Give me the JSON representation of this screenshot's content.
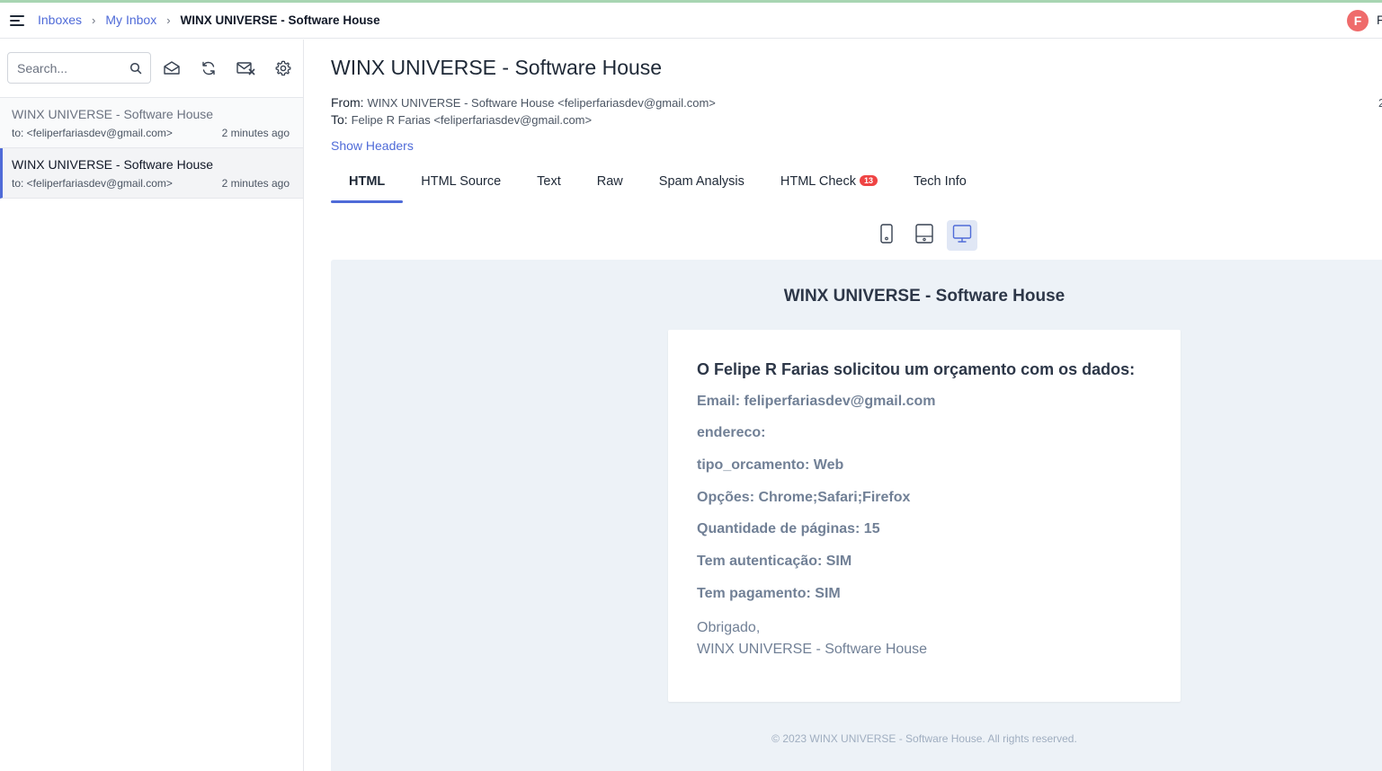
{
  "breadcrumb": {
    "inboxes": "Inboxes",
    "my_inbox": "My Inbox",
    "current": "WINX UNIVERSE - Software House"
  },
  "user": {
    "initial": "F",
    "cut_text": "F"
  },
  "sidebar": {
    "search_placeholder": "Search...",
    "messages": [
      {
        "subject": "WINX UNIVERSE - Software House",
        "to": "to: <feliperfariasdev@gmail.com>",
        "time": "2 minutes ago",
        "active": false
      },
      {
        "subject": "WINX UNIVERSE - Software House",
        "to": "to: <feliperfariasdev@gmail.com>",
        "time": "2 minutes ago",
        "active": true
      }
    ]
  },
  "email": {
    "title": "WINX UNIVERSE - Software House",
    "from_label": "From:",
    "from_value": "WINX UNIVERSE - Software House <feliperfariasdev@gmail.com>",
    "to_label": "To:",
    "to_value": "Felipe R Farias <feliperfariasdev@gmail.com>",
    "date_cut": "2",
    "show_headers": "Show Headers"
  },
  "tabs": [
    {
      "label": "HTML",
      "active": true
    },
    {
      "label": "HTML Source"
    },
    {
      "label": "Text"
    },
    {
      "label": "Raw"
    },
    {
      "label": "Spam Analysis"
    },
    {
      "label": "HTML Check",
      "badge": "13"
    },
    {
      "label": "Tech Info"
    }
  ],
  "devices": [
    "phone-icon",
    "tablet-icon",
    "desktop-icon"
  ],
  "preview": {
    "heading": "WINX UNIVERSE - Software House",
    "card_title": "O Felipe R Farias solicitou um orçamento com os dados:",
    "fields": [
      "Email: feliperfariasdev@gmail.com",
      "endereco:",
      "tipo_orcamento: Web",
      "Opções: Chrome;Safari;Firefox",
      "Quantidade de páginas: 15",
      "Tem autenticação: SIM",
      "Tem pagamento: SIM"
    ],
    "thanks_line1": "Obrigado,",
    "thanks_line2": "WINX UNIVERSE - Software House",
    "footer": "© 2023 WINX UNIVERSE - Software House. All rights reserved."
  },
  "colors": {
    "accent": "#4f6bd8",
    "badge": "#ef4444",
    "avatar": "#ef6b6b",
    "preview_bg": "#edf2f7"
  }
}
